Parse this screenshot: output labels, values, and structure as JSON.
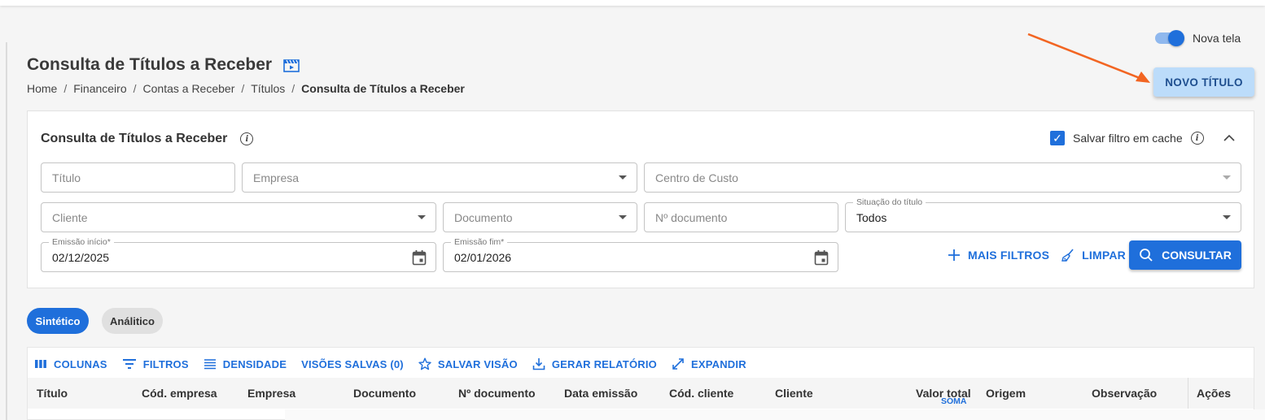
{
  "toggle": {
    "label": "Nova tela",
    "on": true
  },
  "page": {
    "title": "Consulta de Títulos a Receber",
    "breadcrumb": [
      "Home",
      "Financeiro",
      "Contas a Receber",
      "Títulos",
      "Consulta de Títulos a Receber"
    ],
    "novo_button": "NOVO TÍTULO"
  },
  "filter_card": {
    "title": "Consulta de Títulos a Receber",
    "save_cache_label": "Salvar filtro em cache",
    "save_cache_checked": true,
    "fields": {
      "titulo": {
        "placeholder": "Título"
      },
      "empresa": {
        "placeholder": "Empresa"
      },
      "centro_custo": {
        "placeholder": "Centro de Custo"
      },
      "cliente": {
        "placeholder": "Cliente"
      },
      "documento": {
        "placeholder": "Documento"
      },
      "n_documento": {
        "placeholder": "Nº documento"
      },
      "situacao": {
        "label": "Situação do título",
        "value": "Todos"
      },
      "emissao_inicio": {
        "label": "Emissão início*",
        "value": "02/12/2025"
      },
      "emissao_fim": {
        "label": "Emissão fim*",
        "value": "02/01/2026"
      }
    },
    "mais_filtros": "MAIS FILTROS",
    "limpar": "LIMPAR",
    "consultar": "CONSULTAR"
  },
  "view_tabs": {
    "sintetico": "Sintético",
    "analitico": "Análitico"
  },
  "grid": {
    "toolbar": {
      "colunas": "COLUNAS",
      "filtros": "FILTROS",
      "densidade": "DENSIDADE",
      "visoes_salvas": "VISÕES SALVAS (0)",
      "salvar_visao": "SALVAR VISÃO",
      "gerar_relatorio": "GERAR RELATÓRIO",
      "expandir": "EXPANDIR"
    },
    "columns": [
      "Título",
      "Cód. empresa",
      "Empresa",
      "Documento",
      "Nº documento",
      "Data emissão",
      "Cód. cliente",
      "Cliente",
      "Valor total",
      "Origem",
      "Observação",
      "Ações"
    ],
    "soma_label": "SOMA"
  },
  "colors": {
    "accent": "#1f6fdb",
    "arrow": "#f26522"
  }
}
